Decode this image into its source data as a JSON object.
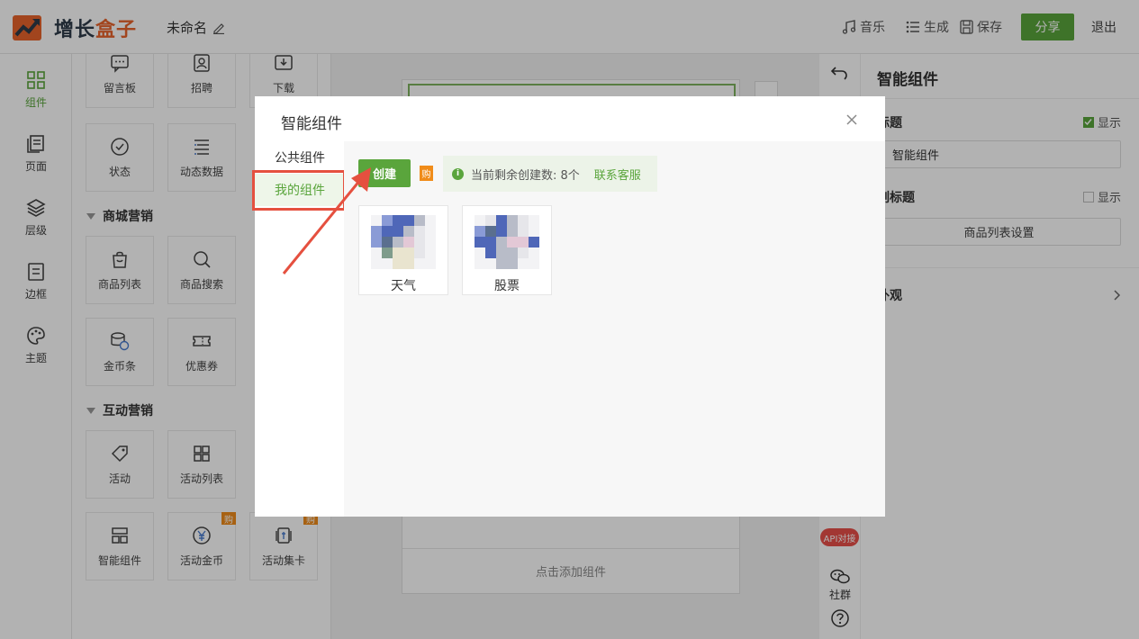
{
  "topbar": {
    "brand_a": "增长",
    "brand_b": "盒子",
    "doc_name": "未命名",
    "music": "音乐",
    "generate": "生成",
    "save": "保存",
    "share": "分享",
    "exit": "退出"
  },
  "nav": {
    "items": [
      {
        "label": "组件",
        "icon": "grid-icon",
        "active": true
      },
      {
        "label": "页面",
        "icon": "pages-icon"
      },
      {
        "label": "层级",
        "icon": "layers-icon"
      },
      {
        "label": "边框",
        "icon": "border-icon"
      },
      {
        "label": "主题",
        "icon": "palette-icon"
      }
    ]
  },
  "panel": {
    "row1": [
      "留言板",
      "招聘",
      "下载"
    ],
    "row2": [
      "状态",
      "动态数据"
    ],
    "section_mall": "商城营销",
    "row3": [
      "商品列表",
      "商品搜索"
    ],
    "row4": [
      "金币条",
      "优惠券"
    ],
    "section_interact": "互动营销",
    "row5": [
      "活动",
      "活动列表"
    ],
    "row6": [
      "智能组件",
      "活动金币",
      "活动集卡"
    ],
    "buy_badge": "购"
  },
  "canvas": {
    "add_hint": "点击添加组件"
  },
  "strip": {
    "api": "API对接",
    "community": "社群"
  },
  "props": {
    "title": "智能组件",
    "title_label": "标题",
    "show_label": "显示",
    "title_value": "智能组件",
    "subtitle_label": "副标题",
    "product_settings": "商品列表设置",
    "appearance": "外观"
  },
  "modal": {
    "title": "智能组件",
    "tabs": [
      "公共组件",
      "我的组件"
    ],
    "create": "创建",
    "buy": "购",
    "quota_text": "当前剩余创建数: 8个",
    "contact": "联系客服",
    "cards": [
      "天气",
      "股票"
    ]
  },
  "colors": {
    "accent": "#5aa53c",
    "highlight": "#e5503f",
    "badge": "#f08c1a"
  }
}
